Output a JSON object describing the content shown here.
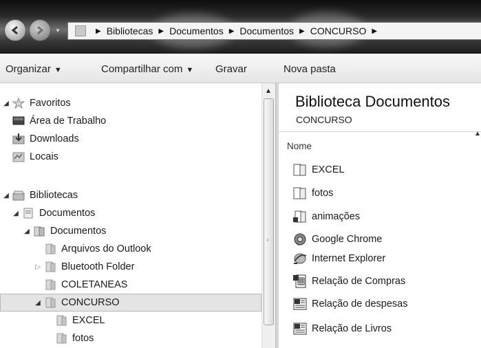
{
  "address": {
    "crumbs": [
      "Bibliotecas",
      "Documentos",
      "Documentos",
      "CONCURSO"
    ]
  },
  "toolbar": {
    "organizar": "Organizar",
    "compartilhar": "Compartilhar com",
    "gravar": "Gravar",
    "nova_pasta": "Nova pasta"
  },
  "nav": {
    "favoritos": "Favoritos",
    "area_trabalho": "Área de Trabalho",
    "downloads": "Downloads",
    "locais": "Locais",
    "bibliotecas": "Bibliotecas",
    "documentos_lib": "Documentos",
    "documentos_folder": "Documentos",
    "arquivos_outlook": "Arquivos do Outlook",
    "bluetooth": "Bluetooth Folder",
    "coletaneas": "COLETANEAS",
    "concurso": "CONCURSO",
    "excel": "EXCEL",
    "fotos": "fotos"
  },
  "content": {
    "title": "Biblioteca Documentos",
    "subtitle": "CONCURSO",
    "column_name": "Nome",
    "files": [
      {
        "name": "EXCEL",
        "icon": "folder-icon"
      },
      {
        "name": "fotos",
        "icon": "folder-icon"
      },
      {
        "name": "animações",
        "icon": "media-folder-icon"
      },
      {
        "name": "Google Chrome",
        "icon": "chrome-icon"
      },
      {
        "name": "Internet Explorer",
        "icon": "ie-icon"
      },
      {
        "name": "Relação de Compras",
        "icon": "excel-doc-icon"
      },
      {
        "name": "Relação de despesas",
        "icon": "word-doc-icon"
      },
      {
        "name": "Relação de Livros",
        "icon": "word-doc-icon"
      }
    ]
  }
}
